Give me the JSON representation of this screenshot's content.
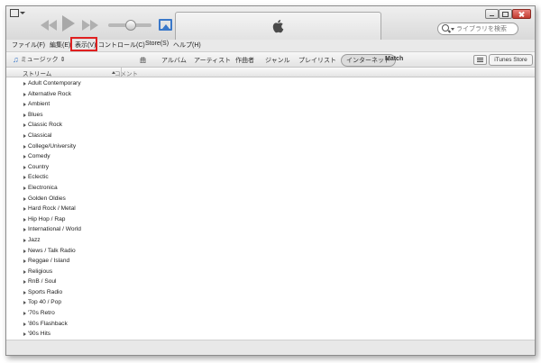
{
  "search": {
    "placeholder": "ライブラリを検索"
  },
  "menubar": {
    "items": [
      "ファイル(F)",
      "編集(E)",
      "表示(V)",
      "コントロール(C)",
      "Store(S)",
      "ヘルプ(H)"
    ]
  },
  "navbar": {
    "library_label": "ミュージック",
    "items": [
      "曲",
      "アルバム",
      "アーティスト",
      "作曲者",
      "ジャンル",
      "プレイリスト",
      "インターネット",
      "Match"
    ],
    "store_label": "iTunes Store"
  },
  "list": {
    "headers": [
      "ストリーム",
      "コメント"
    ],
    "rows": [
      "Adult Contemporary",
      "Alternative Rock",
      "Ambient",
      "Blues",
      "Classic Rock",
      "Classical",
      "College/University",
      "Comedy",
      "Country",
      "Eclectic",
      "Electronica",
      "Golden Oldies",
      "Hard Rock / Metal",
      "Hip Hop / Rap",
      "International / World",
      "Jazz",
      "News / Talk Radio",
      "Reggae / Island",
      "Religious",
      "RnB / Soul",
      "Sports Radio",
      "Top 40 / Pop",
      "'70s Retro",
      "'80s Flashback",
      "'90s Hits"
    ]
  },
  "player": {
    "volume_fraction": 0.5
  },
  "colors": {
    "accent_blue": "#3a78c9",
    "highlight_red": "#e02020"
  },
  "icons": {
    "sys_menu": "window-menu-icon",
    "rewind": "rewind-icon",
    "play": "play-icon",
    "forward": "fast-forward-icon",
    "airplay": "airplay-icon",
    "apple": "apple-logo-icon",
    "search": "search-icon",
    "library": "music-note-icon"
  }
}
